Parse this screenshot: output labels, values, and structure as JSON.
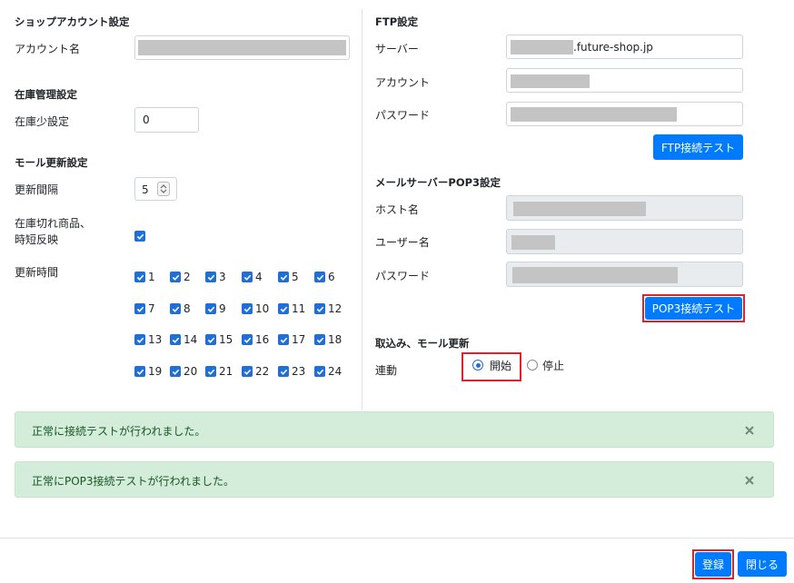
{
  "shop": {
    "title": "ショップアカウント設定",
    "account_label": "アカウント名"
  },
  "stock": {
    "title": "在庫管理設定",
    "low_label": "在庫少設定",
    "low_value": "0"
  },
  "mall": {
    "title": "モール更新設定",
    "interval_label": "更新間隔",
    "interval_value": "5",
    "outofstock_label_1": "在庫切れ商品、",
    "outofstock_label_2": "時短反映",
    "hours_label": "更新時間",
    "hours": [
      "1",
      "2",
      "3",
      "4",
      "5",
      "6",
      "7",
      "8",
      "9",
      "10",
      "11",
      "12",
      "13",
      "14",
      "15",
      "16",
      "17",
      "18",
      "19",
      "20",
      "21",
      "22",
      "23",
      "24"
    ]
  },
  "ftp": {
    "title": "FTP設定",
    "server_label": "サーバー",
    "server_suffix": ".future-shop.jp",
    "account_label": "アカウント",
    "password_label": "パスワード",
    "test_button": "FTP接続テスト"
  },
  "pop3": {
    "title": "メールサーバーPOP3設定",
    "host_label": "ホスト名",
    "user_label": "ユーザー名",
    "password_label": "パスワード",
    "test_button": "POP3接続テスト"
  },
  "import": {
    "title": "取込み、モール更新",
    "link_label": "連動",
    "option_start": "開始",
    "option_stop": "停止"
  },
  "alerts": [
    "正常に接続テストが行われました。",
    "正常にPOP3接続テストが行われました。"
  ],
  "footer": {
    "register": "登録",
    "close": "閉じる"
  },
  "colors": {
    "primary": "#007bff",
    "highlight": "#d9232e",
    "alert_bg": "#d4edda",
    "alert_text": "#155724"
  }
}
